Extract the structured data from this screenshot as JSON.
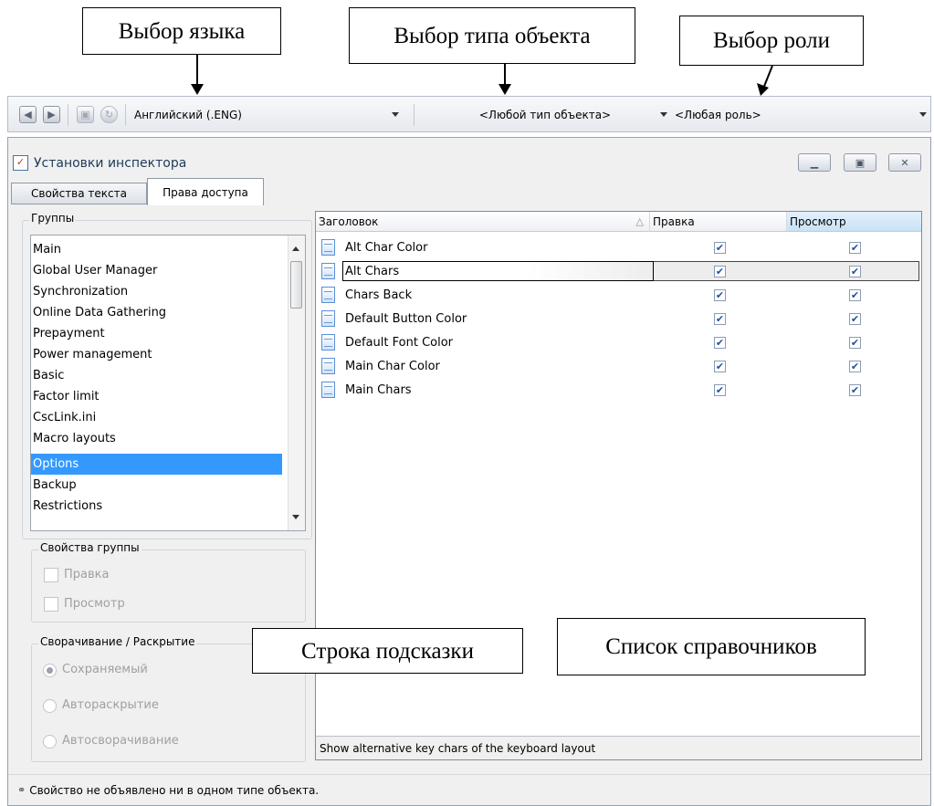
{
  "callouts": {
    "language": "Выбор языка",
    "object_type": "Выбор типа объекта",
    "role": "Выбор роли",
    "hint_line": "Строка подсказки",
    "reference_list": "Список справочников"
  },
  "toolbar": {
    "language_value": "Английский (.ENG)",
    "object_type_value": "<Любой тип объекта>",
    "role_value": "<Любая роль>"
  },
  "window": {
    "title": "Установки инспектора"
  },
  "tabs": [
    {
      "label": "Свойства текста"
    },
    {
      "label": "Права доступа"
    }
  ],
  "groups": {
    "title": "Группы",
    "items": [
      "Main",
      "Global User Manager",
      "Synchronization",
      "Online Data Gathering",
      "Prepayment",
      "Power management",
      "Basic",
      "Factor limit",
      "CscLink.ini",
      "Macro layouts",
      "Options",
      "Backup",
      "Restrictions"
    ],
    "selected": "Options"
  },
  "group_properties": {
    "title": "Свойства группы",
    "edit_label": "Правка",
    "view_label": "Просмотр"
  },
  "collapse": {
    "title": "Сворачивание / Раскрытие",
    "options": [
      "Сохраняемый",
      "Автораскрытие",
      "Автосворачивание"
    ],
    "selected": "Сохраняемый"
  },
  "grid": {
    "columns": {
      "header": "Заголовок",
      "edit": "Правка",
      "view": "Просмотр"
    },
    "rows": [
      {
        "name": "Alt Char Color",
        "edit": true,
        "view": true
      },
      {
        "name": "Alt Chars",
        "edit": true,
        "view": true
      },
      {
        "name": "Chars Back",
        "edit": true,
        "view": true
      },
      {
        "name": "Default Button Color",
        "edit": true,
        "view": true
      },
      {
        "name": "Default Font Color",
        "edit": true,
        "view": true
      },
      {
        "name": "Main Char Color",
        "edit": true,
        "view": true
      },
      {
        "name": "Main Chars",
        "edit": true,
        "view": true
      }
    ]
  },
  "hint_text": "Show alternative key chars of the keyboard layout",
  "status_text": "Свойство не объявлено ни в одном типе объекта."
}
